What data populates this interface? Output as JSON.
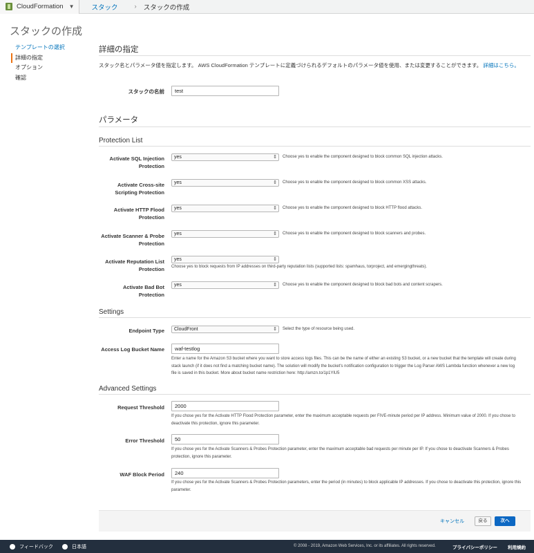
{
  "topbar": {
    "service_name": "CloudFormation",
    "breadcrumb_link": "スタック",
    "breadcrumb_sep": "›",
    "breadcrumb_current": "スタックの作成"
  },
  "page_title": "スタックの作成",
  "leftnav": {
    "items": [
      "テンプレートの選択",
      "詳細の指定",
      "オプション",
      "確認"
    ]
  },
  "details": {
    "heading": "詳細の指定",
    "description": "スタック名とパラメータ値を指定します。 AWS CloudFormation テンプレートに定義づけられるデフォルトのパラメータ値を使用、または変更することができます。",
    "more_link": "詳細はこちら。",
    "stack_name_label": "スタックの名前",
    "stack_name_value": "test"
  },
  "params_heading": "パラメータ",
  "protection": {
    "heading": "Protection List",
    "rows": [
      {
        "label": "Activate SQL Injection Protection",
        "value": "yes",
        "help": "Choose yes to enable the component designed to block common SQL injection attacks."
      },
      {
        "label": "Activate Cross-site Scripting Protection",
        "value": "yes",
        "help": "Choose yes to enable the component designed to block common XSS attacks."
      },
      {
        "label": "Activate HTTP Flood Protection",
        "value": "yes",
        "help": "Choose yes to enable the component designed to block HTTP flood attacks."
      },
      {
        "label": "Activate Scanner & Probe Protection",
        "value": "yes",
        "help": "Choose yes to enable the component designed to block scanners and probes."
      },
      {
        "label": "Activate Reputation List Protection",
        "value": "yes",
        "help": "Choose yes to block requests from IP addresses on third-party reputation lists (supported lists: spamhaus, torproject, and emergingthreats)."
      },
      {
        "label": "Activate Bad Bot Protection",
        "value": "yes",
        "help": "Choose yes to enable the component designed to block bad bots and content scrapers."
      }
    ]
  },
  "settings": {
    "heading": "Settings",
    "endpoint_label": "Endpoint Type",
    "endpoint_value": "CloudFront",
    "endpoint_help": "Select the type of resource being used.",
    "bucket_label": "Access Log Bucket Name",
    "bucket_value": "waf-testlog",
    "bucket_help": "Enter a name for the Amazon S3 bucket where you want to store access logs files. This can be the name of either an existing S3 bucket, or a new bucket that the template will create during stack launch (if it does not find a matching bucket name). The solution will modify the bucket's notification configuration to trigger the Log Parser AWS Lambda function whenever a new log file is saved in this bucket. More about bucket name restriction here: http://amzn.to/1p1YlU5"
  },
  "advanced": {
    "heading": "Advanced Settings",
    "request_label": "Request Threshold",
    "request_value": "2000",
    "request_help": "If you chose yes for the Activate HTTP Flood Protection parameter, enter the maximum acceptable requests per FIVE-minute period per IP address. Minimum value of 2000. If you chose to deactivate this protection, ignore this parameter.",
    "error_label": "Error Threshold",
    "error_value": "50",
    "error_help": "If you chose yes for the Activate Scanners & Probes Protection parameter, enter the maximum acceptable bad requests per minute per IP. If you chose to deactivate Scanners & Probes protection, ignore this parameter.",
    "block_label": "WAF Block Period",
    "block_value": "240",
    "block_help": "If you chose yes for the Activate Scanners & Probes Protection parameters, enter the period (in minutes) to block applicable IP addresses. If you chose to deactivate this protection, ignore this parameter."
  },
  "actions": {
    "cancel": "キャンセル",
    "back": "戻る",
    "next": "次へ"
  },
  "bottombar": {
    "feedback": "フィードバック",
    "language": "日本語",
    "copyright": "© 2008 - 2019, Amazon Web Services, Inc. or its affiliates. All rights reserved.",
    "privacy": "プライバシーポリシー",
    "terms": "利用規約"
  }
}
